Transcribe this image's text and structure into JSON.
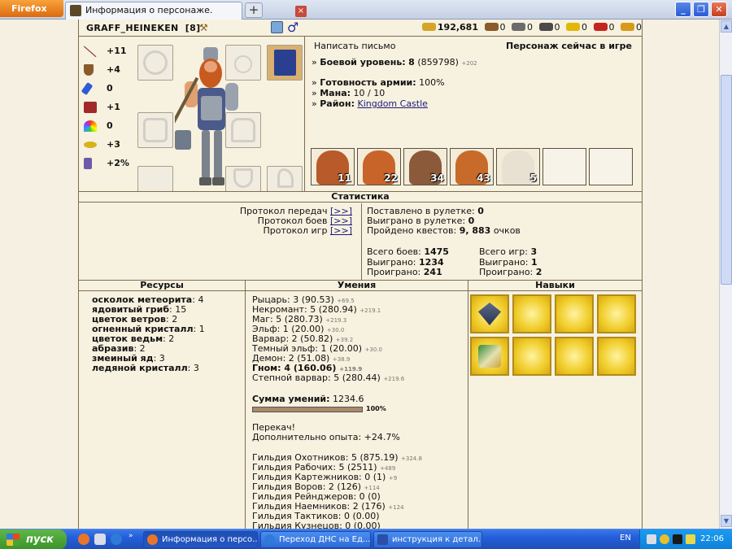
{
  "browser": {
    "menu_label": "Firefox",
    "tab_title": "Информация о персонаже.",
    "new_tab": "+",
    "close_tab": "×"
  },
  "player": {
    "name": "GRAFF_HEINEKEN",
    "level": "[8]",
    "gender_symbol": "♂"
  },
  "resources_top": [
    {
      "icon": "gold-icon",
      "value": "192,681",
      "color": "#d4a52a"
    },
    {
      "icon": "wood-icon",
      "value": "0",
      "color": "#8a5a2b"
    },
    {
      "icon": "ore-icon",
      "value": "0",
      "color": "#6b6b6b"
    },
    {
      "icon": "mercury-icon",
      "value": "0",
      "color": "#5a5a5a"
    },
    {
      "icon": "sulfur-icon",
      "value": "0",
      "color": "#e0b80a"
    },
    {
      "icon": "crystal-icon",
      "value": "0",
      "color": "#c2261e"
    },
    {
      "icon": "gem-icon",
      "value": "0",
      "color": "#d89a1a"
    }
  ],
  "stats": [
    {
      "icon": "attack-icon",
      "value": "+11",
      "color": "#8a1f1f"
    },
    {
      "icon": "defense-icon",
      "value": "+4",
      "color": "#8a5a2b"
    },
    {
      "icon": "spellpower-icon",
      "value": "0",
      "color": "#2f5ad8"
    },
    {
      "icon": "knowledge-icon",
      "value": "+1",
      "color": "#a02a2a"
    },
    {
      "icon": "luck-icon",
      "value": "0",
      "color": "#d85a1a"
    },
    {
      "icon": "morale-icon",
      "value": "+3",
      "color": "#d8b21a"
    },
    {
      "icon": "initiative-icon",
      "value": "+2%",
      "color": "#6a5aa8"
    }
  ],
  "profile": {
    "write_letter": "Написать письмо",
    "online_status": "Персонаж сейчас в игре",
    "combat_level_label": "Боевой уровень:",
    "combat_level": "8",
    "combat_exp": "(859798)",
    "combat_exp_delta": "+202",
    "army_ready_label": "Готовность армии:",
    "army_ready": "100%",
    "mana_label": "Мана:",
    "mana": "10 / 10",
    "district_label": "Район:",
    "district": "Kingdom Castle"
  },
  "army": [
    {
      "count": "11",
      "color": "#b85a2a"
    },
    {
      "count": "22",
      "color": "#c8642a"
    },
    {
      "count": "34",
      "color": "#a0502a"
    },
    {
      "count": "43",
      "color": "#c86a2a"
    },
    {
      "count": "5",
      "color": "#e8e0d0"
    },
    {
      "count": "",
      "color": ""
    },
    {
      "count": "",
      "color": ""
    }
  ],
  "statistics": {
    "title": "Статистика",
    "protocols": [
      {
        "label": "Протокол передач",
        "link": "[>>]"
      },
      {
        "label": "Протокол боев",
        "link": "[>>]"
      },
      {
        "label": "Протокол игр",
        "link": "[>>]"
      }
    ],
    "roulette_bet_label": "Поставлено в рулетке:",
    "roulette_bet": "0",
    "roulette_won_label": "Выиграно в рулетке:",
    "roulette_won": "0",
    "quests_label": "Пройдено квестов:",
    "quests": "9, 883",
    "quests_unit": "очков",
    "battles_total_label": "Всего боев:",
    "battles_total": "1475",
    "battles_won_label": "Выиграно:",
    "battles_won": "1234",
    "battles_lost_label": "Проиграно:",
    "battles_lost": "241",
    "games_total_label": "Всего игр:",
    "games_total": "3",
    "games_won_label": "Выиграно:",
    "games_won": "1",
    "games_lost_label": "Проиграно:",
    "games_lost": "2"
  },
  "resources": {
    "title": "Ресурсы",
    "items": [
      {
        "name": "осколок метеорита",
        "count": "4"
      },
      {
        "name": "ядовитый гриб",
        "count": "15"
      },
      {
        "name": "цветок ветров",
        "count": "2"
      },
      {
        "name": "огненный кристалл",
        "count": "1"
      },
      {
        "name": "цветок ведьм",
        "count": "2"
      },
      {
        "name": "абразив",
        "count": "2"
      },
      {
        "name": "змеиный яд",
        "count": "3"
      },
      {
        "name": "ледяной кристалл",
        "count": "3"
      }
    ]
  },
  "skills": {
    "title": "Умения",
    "factions": [
      {
        "text": "Рыцарь: 3 (90.53)",
        "delta": "+69.5"
      },
      {
        "text": "Некромант: 5 (280.94)",
        "delta": "+219.1"
      },
      {
        "text": "Маг: 5 (280.73)",
        "delta": "+219.3"
      },
      {
        "text": "Эльф: 1 (20.00)",
        "delta": "+30.0"
      },
      {
        "text": "Варвар: 2 (50.82)",
        "delta": "+39.2"
      },
      {
        "text": "Темный эльф: 1 (20.00)",
        "delta": "+30.0"
      },
      {
        "text": "Демон: 2 (51.08)",
        "delta": "+38.9"
      },
      {
        "text": "Гном: 4 (160.06)",
        "delta": "+119.9"
      },
      {
        "text": "Степной варвар: 5 (280.44)",
        "delta": "+219.6"
      }
    ],
    "sum_label": "Сумма умений:",
    "sum_value": "1234.6",
    "progress": "100%",
    "overleveled": "Перекач!",
    "extra_exp": "Дополнительно опыта: +24.7%",
    "guilds": [
      {
        "text": "Гильдия Охотников: 5 (875.19)",
        "delta": "+324.8"
      },
      {
        "text": "Гильдия Рабочих: 5 (2511)",
        "delta": "+489"
      },
      {
        "text": "Гильдия Картежников: 0 (1)",
        "delta": "+9"
      },
      {
        "text": "Гильдия Воров: 2 (126)",
        "delta": "+114"
      },
      {
        "text": "Гильдия Рейнджеров: 0 (0)",
        "delta": ""
      },
      {
        "text": "Гильдия Наемников: 2 (176)",
        "delta": "+124"
      },
      {
        "text": "Гильдия Тактиков: 0 (0.00)",
        "delta": ""
      },
      {
        "text": "Гильдия Кузнецов: 0 (0.00)",
        "delta": ""
      }
    ]
  },
  "talents": {
    "title": "Навыки",
    "slots": [
      "emblem-icon",
      "",
      "",
      "",
      "scroll-icon",
      "",
      "",
      ""
    ]
  },
  "taskbar": {
    "start": "пуск",
    "buttons": [
      "Информация о персо...",
      "Переход ДНС на Ед...",
      "инструкция к детал..."
    ],
    "lang": "EN",
    "time": "22:06"
  }
}
